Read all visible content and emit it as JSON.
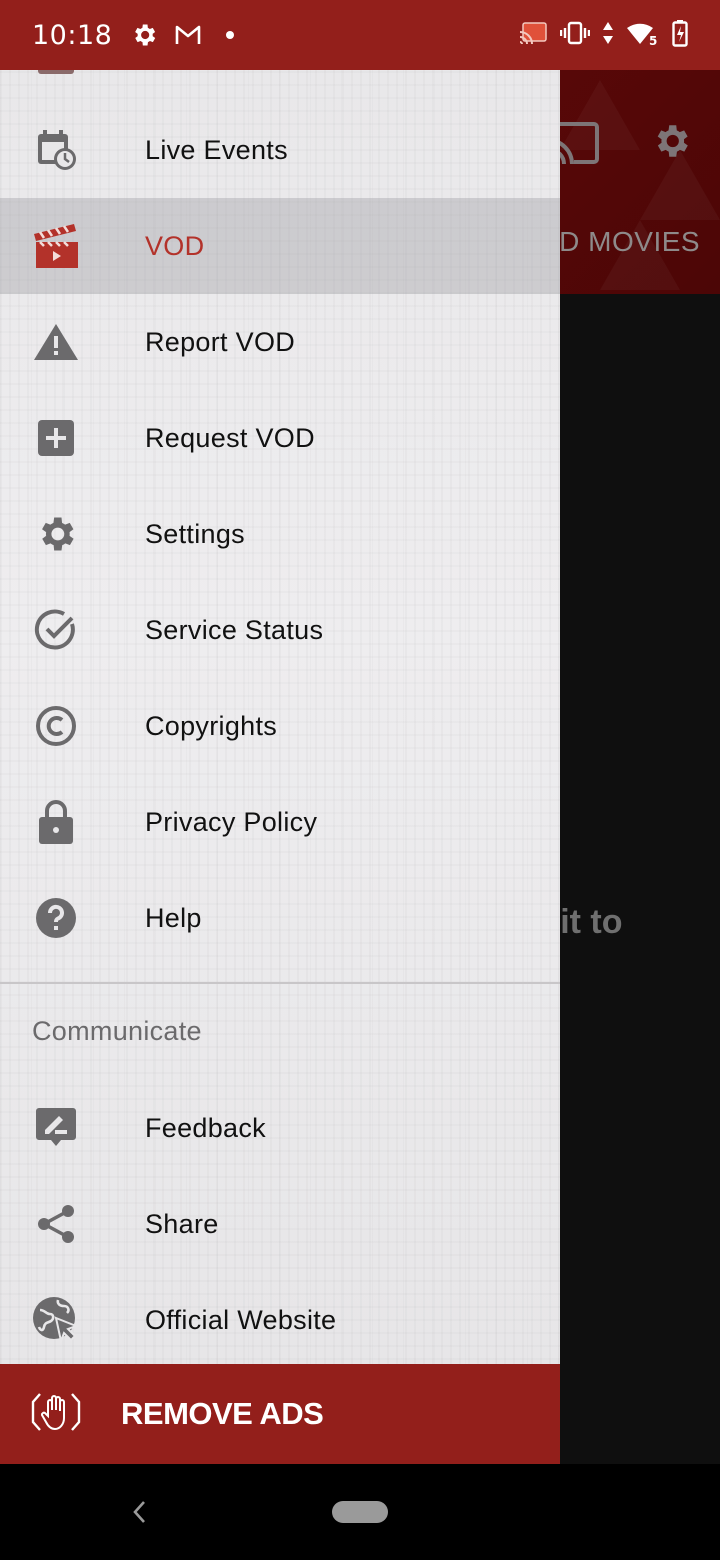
{
  "status_bar": {
    "time": "10:18",
    "left_icons": [
      "settings-icon",
      "gmail-icon",
      "notification-dot"
    ],
    "right_icons": [
      "cast-connected-icon",
      "vibrate-icon",
      "data-arrows-icon",
      "wifi-icon",
      "battery-charging-icon"
    ],
    "wifi_label": "5"
  },
  "background_app": {
    "header_icons": [
      "cast-icon",
      "settings-icon"
    ],
    "visible_tab_fragment": "ED MOVIES",
    "visible_body_fragment": "d it to"
  },
  "drawer": {
    "items": [
      {
        "label": "Live Events",
        "icon": "calendar-clock-icon",
        "active": false
      },
      {
        "label": "VOD",
        "icon": "clapperboard-icon",
        "active": true
      },
      {
        "label": "Report VOD",
        "icon": "warning-icon",
        "active": false
      },
      {
        "label": "Request VOD",
        "icon": "add-box-icon",
        "active": false
      },
      {
        "label": "Settings",
        "icon": "gear-icon",
        "active": false
      },
      {
        "label": "Service Status",
        "icon": "check-circle-icon",
        "active": false
      },
      {
        "label": "Copyrights",
        "icon": "copyright-icon",
        "active": false
      },
      {
        "label": "Privacy Policy",
        "icon": "lock-icon",
        "active": false
      },
      {
        "label": "Help",
        "icon": "help-icon",
        "active": false
      }
    ],
    "communicate_section": {
      "header": "Communicate",
      "items": [
        {
          "label": "Feedback",
          "icon": "feedback-icon"
        },
        {
          "label": "Share",
          "icon": "share-icon"
        },
        {
          "label": "Official Website",
          "icon": "globe-cursor-icon"
        }
      ]
    },
    "remove_ads": {
      "label": "REMOVE ADS",
      "icon": "stop-hand-icon"
    }
  },
  "colors": {
    "brand_red": "#931f1b",
    "active_label": "#b3322a",
    "icon_gray": "#6b6a6c"
  }
}
